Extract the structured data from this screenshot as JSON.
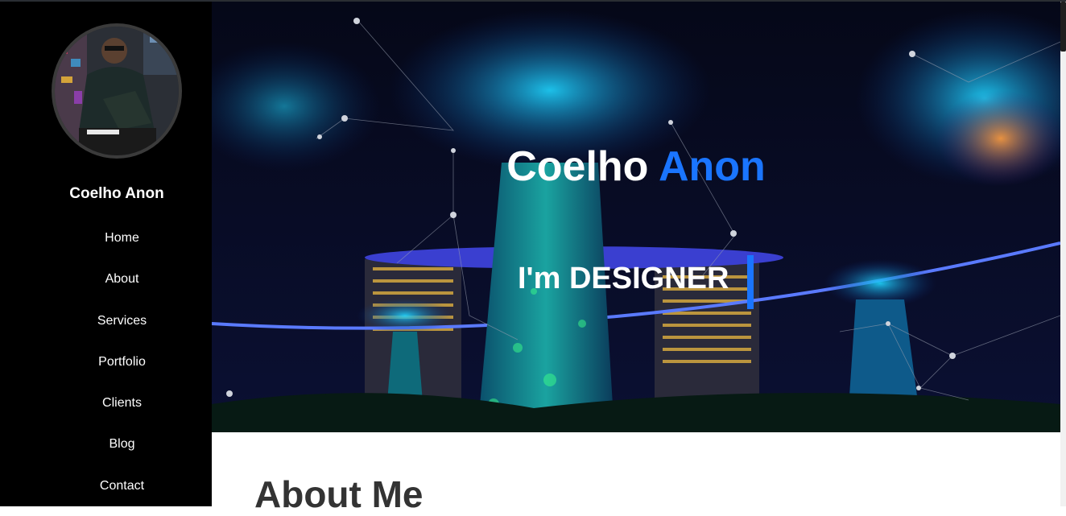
{
  "profile": {
    "name": "Coelho Anon",
    "avatar_alt": "profile photo"
  },
  "nav": {
    "items": [
      {
        "label": "Home"
      },
      {
        "label": "About"
      },
      {
        "label": "Services"
      },
      {
        "label": "Portfolio"
      },
      {
        "label": "Clients"
      },
      {
        "label": "Blog"
      },
      {
        "label": "Contact"
      }
    ]
  },
  "hero": {
    "first_name": "Coelho",
    "last_name": "Anon",
    "typed_text": "I'm DESIGNER",
    "background": "night-garden-supertrees-image"
  },
  "about": {
    "heading": "About Me"
  },
  "colors": {
    "accent": "#1a75ff",
    "sidebar_bg": "#000000",
    "heading_text": "#333333"
  }
}
